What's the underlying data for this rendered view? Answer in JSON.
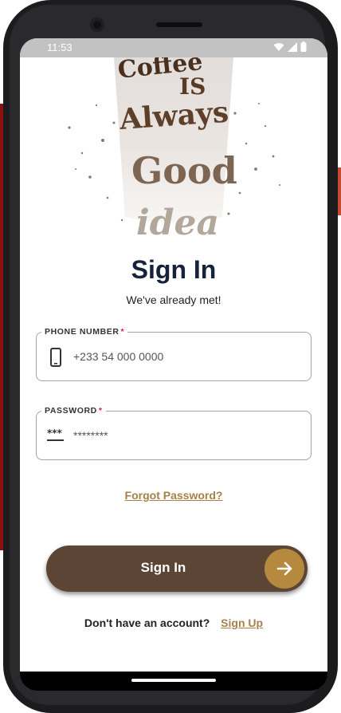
{
  "status_bar": {
    "time": "11:53",
    "icons": [
      "wifi-icon",
      "signal-icon",
      "battery-icon"
    ]
  },
  "hero": {
    "artwork": "coffee-cup-lettering",
    "words": [
      "Coffee",
      "IS",
      "Always",
      "Good",
      "idea"
    ]
  },
  "title": "Sign In",
  "subtitle": "We've already met!",
  "phone_field": {
    "label": "PHONE NUMBER",
    "required_mark": "*",
    "placeholder": "+233 54 000 0000",
    "icon": "smartphone-icon"
  },
  "password_field": {
    "label": "PASSWORD",
    "required_mark": "*",
    "placeholder": "********",
    "icon": "password-icon"
  },
  "forgot_password": "Forgot Password?",
  "sign_in_button": {
    "label": "Sign In",
    "icon": "arrow-right-icon"
  },
  "signup": {
    "question": "Don't have an account?",
    "link": "Sign Up"
  },
  "colors": {
    "primary_button": "#5d4535",
    "accent": "#b58a3f",
    "link": "#a6814a",
    "title": "#17223b",
    "required": "#d6263a"
  }
}
